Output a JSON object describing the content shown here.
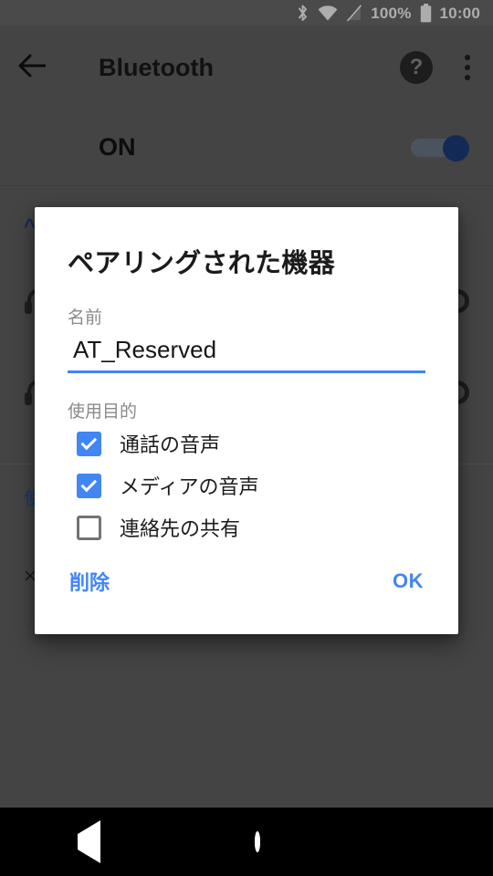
{
  "status_bar": {
    "bluetooth_icon": "bluetooth-icon",
    "wifi_icon": "wifi-icon",
    "signal_icon": "cellular-no-sim-icon",
    "battery_percent": "100%",
    "battery_icon": "battery-full-icon",
    "time": "10:00"
  },
  "toolbar": {
    "back_icon": "arrow-back-icon",
    "title": "Bluetooth",
    "help_icon": "?",
    "overflow_icon": "more-vertical-icon"
  },
  "master_switch": {
    "label": "ON",
    "state": "on"
  },
  "background_list": {
    "section_caret": "^",
    "devices": [
      {
        "name": "",
        "icon": "headset-icon",
        "settings_icon": "gear-icon"
      },
      {
        "name": "",
        "icon": "headset-icon",
        "settings_icon": "gear-icon"
      }
    ],
    "link_text": "使",
    "plus_text": "×"
  },
  "dialog": {
    "title": "ペアリングされた機器",
    "name_label": "名前",
    "name_value": "AT_Reserved",
    "name_placeholder": "名前",
    "purpose_label": "使用目的",
    "checkboxes": [
      {
        "label": "通話の音声",
        "checked": true
      },
      {
        "label": "メディアの音声",
        "checked": true
      },
      {
        "label": "連絡先の共有",
        "checked": false
      }
    ],
    "delete_label": "削除",
    "ok_label": "OK"
  },
  "nav_bar": {
    "back": "nav-back-icon",
    "home": "nav-home-icon",
    "recents": "nav-recents-icon"
  },
  "colors": {
    "accent_blue": "#4285f4",
    "scrim": "rgba(0,0,0,0.32)",
    "toolbar_gray": "#656565",
    "status_gray": "#6d6d6d"
  }
}
